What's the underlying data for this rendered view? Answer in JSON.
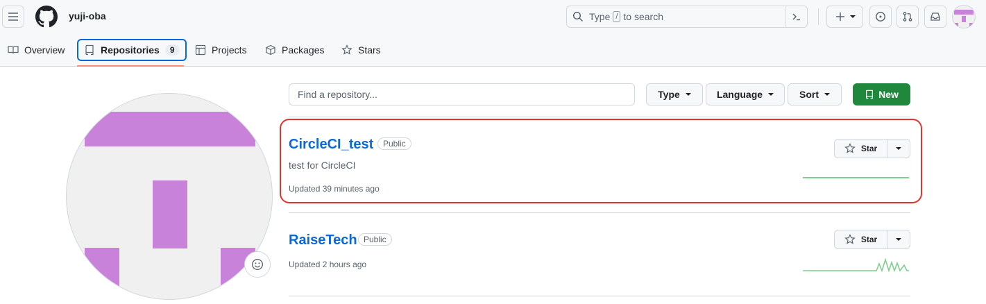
{
  "header": {
    "username": "yuji-oba",
    "search_text_before": "Type",
    "search_key": "/",
    "search_text_after": "to search"
  },
  "nav": {
    "tabs": [
      {
        "label": "Overview"
      },
      {
        "label": "Repositories",
        "count": "9"
      },
      {
        "label": "Projects"
      },
      {
        "label": "Packages"
      },
      {
        "label": "Stars"
      }
    ]
  },
  "filter": {
    "placeholder": "Find a repository...",
    "type_label": "Type",
    "language_label": "Language",
    "sort_label": "Sort",
    "new_label": "New"
  },
  "repos": [
    {
      "name": "CircleCI_test",
      "visibility": "Public",
      "description": "test for CircleCI",
      "updated": "Updated 39 minutes ago",
      "star_label": "Star"
    },
    {
      "name": "RaiseTech",
      "visibility": "Public",
      "description": "",
      "updated": "Updated 2 hours ago",
      "star_label": "Star"
    }
  ],
  "colors": {
    "accent": "#0969da",
    "primary_button": "#1f883d",
    "avatar_pink": "#c982d9",
    "highlight": "#e5322b",
    "sparkline": "#7fcf8f"
  },
  "icons": {
    "menu": "hamburger-icon",
    "logo": "github-mark-icon",
    "search": "search-icon",
    "command": "command-palette-icon",
    "plus": "plus-icon",
    "issues": "issue-circle-icon",
    "pulls": "pull-request-icon",
    "inbox": "inbox-icon",
    "status": "smiley-icon"
  }
}
